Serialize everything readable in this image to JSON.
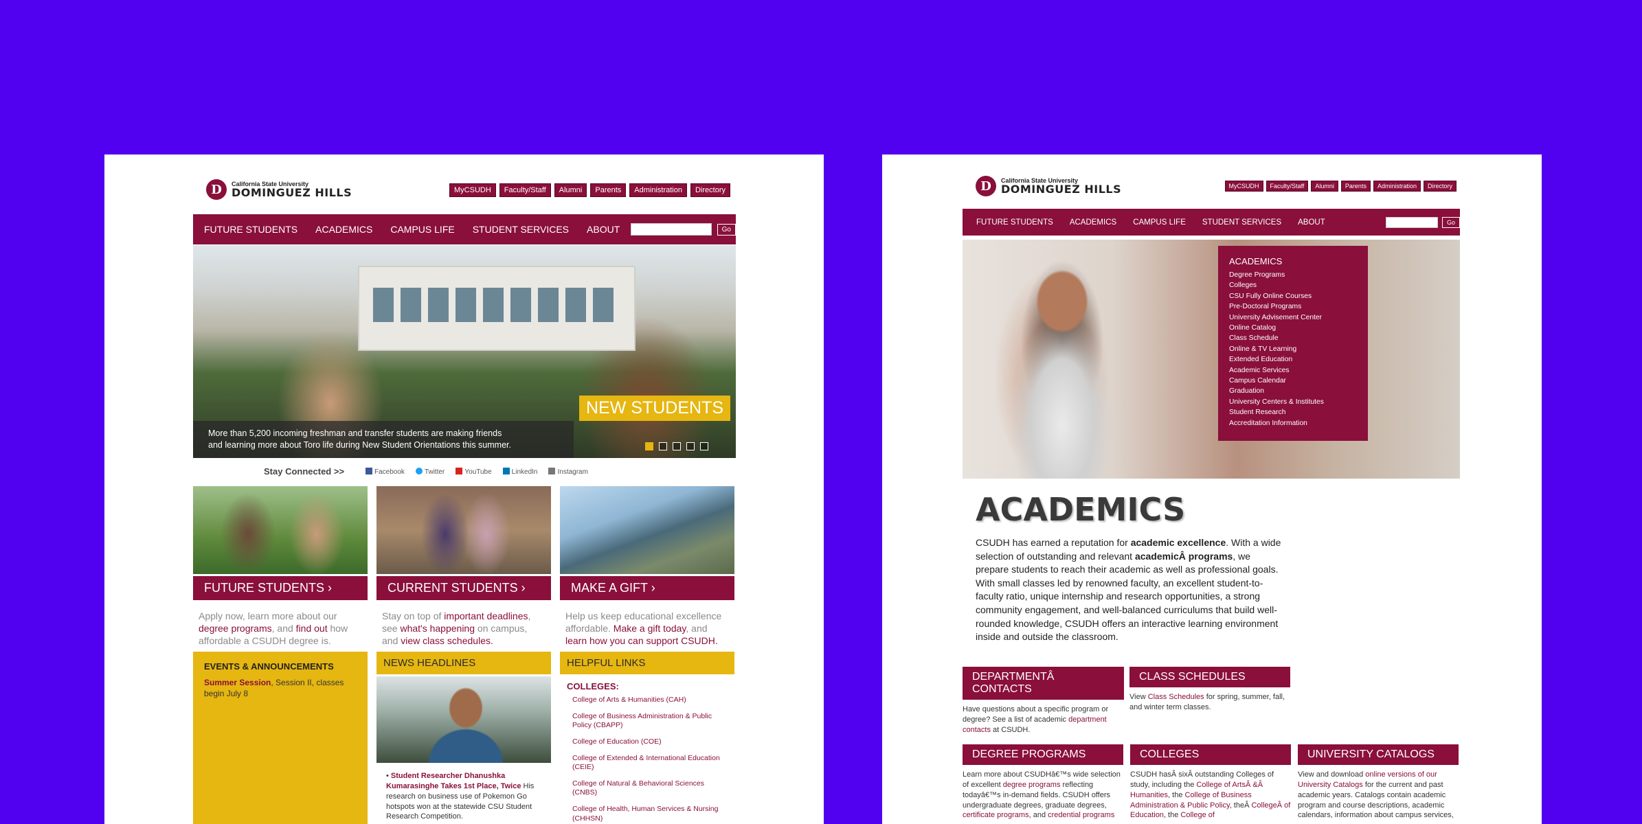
{
  "left": {
    "logo": {
      "line1": "California State University",
      "line2": "DOMINGUEZ HILLS"
    },
    "utility_links": [
      "MyCSUDH",
      "Faculty/Staff",
      "Alumni",
      "Parents",
      "Administration",
      "Directory"
    ],
    "nav": [
      "FUTURE STUDENTS",
      "ACADEMICS",
      "CAMPUS LIFE",
      "STUDENT SERVICES",
      "ABOUT"
    ],
    "search_go": "Go",
    "hero": {
      "caption_line1": "More than 5,200 incoming freshman and transfer students are making friends",
      "caption_line2": "and learning more about Toro life during New Student Orientations this summer.",
      "badge": "NEW STUDENTS",
      "active_slide": 1,
      "slide_count": 5
    },
    "stay_connected": "Stay Connected >>",
    "social": [
      "Facebook",
      "Twitter",
      "YouTube",
      "LinkedIn",
      "Instagram"
    ],
    "cards": [
      {
        "title": "FUTURE STUDENTS ›",
        "t1": "Apply now, learn more about our ",
        "l1": "degree programs",
        "t2": ", and ",
        "l2": "find out",
        "t3": " how affordable a CSUDH degree is."
      },
      {
        "title": "CURRENT STUDENTS ›",
        "t1": "Stay on top of ",
        "l1": "important deadlines",
        "t2": ", see ",
        "l2": "what's happening",
        "t3": " on campus, and ",
        "l3": "view class schedules."
      },
      {
        "title": "MAKE A GIFT ›",
        "t1": "Help us keep educational excellence affordable. ",
        "l1": "Make a gift today",
        "t2": ", and ",
        "l2": "learn how you can support CSUDH."
      }
    ],
    "events": {
      "heading": "EVENTS & ANNOUNCEMENTS",
      "link": "Summer Session",
      "text": ", Session II, classes begin July 8"
    },
    "news": {
      "heading": "NEWS HEADLINES",
      "item_title": "Student Researcher Dhanushka Kumarasinghe Takes 1st Place, Twice",
      "item_text": " His research on business use of Pokemon Go hotspots won at the statewide CSU Student Research Competition."
    },
    "helpful": {
      "heading": "HELPFUL LINKS",
      "sub": "COLLEGES:",
      "items": [
        "College of Arts & Humanities (CAH)",
        "College of Business Administration & Public Policy (CBAPP)",
        "College of Education (COE)",
        "College of Extended & International Education (CEIE)",
        "College of Natural & Behavioral Sciences (CNBS)",
        "College of Health, Human Services & Nursing (CHHSN)"
      ]
    }
  },
  "right": {
    "logo": {
      "line1": "California State University",
      "line2": "DOMINGUEZ HILLS"
    },
    "utility_links": [
      "MyCSUDH",
      "Faculty/Staff",
      "Alumni",
      "Parents",
      "Administration",
      "Directory"
    ],
    "nav": [
      "FUTURE STUDENTS",
      "ACADEMICS",
      "CAMPUS LIFE",
      "STUDENT SERVICES",
      "ABOUT"
    ],
    "search_go": "Go",
    "dropdown": {
      "heading": "ACADEMICS",
      "items": [
        "Degree Programs",
        "Colleges",
        "CSU Fully Online Courses",
        "Pre-Doctoral Programs",
        "University Advisement Center",
        "Online Catalog",
        "Class Schedule",
        "Online & TV Learning",
        "Extended Education",
        "Academic Services",
        "Campus Calendar",
        "Graduation",
        "University Centers & Institutes",
        "Student Research",
        "Accreditation Information"
      ]
    },
    "title": "ACADEMICS",
    "intro": {
      "t1": "CSUDH has earned a reputation for ",
      "b1": "academic excellence",
      "t2": ". With a wide selection of outstanding and relevant ",
      "b2": "academicÂ programs",
      "t3": ", we prepare students to reach their academic as well as professional goals. With small classes led by renowned faculty, an excellent student-to-faculty ratio, unique internship and research opportunities, a strong community engagement, and well-balanced curriculums that build well-rounded knowledge, CSUDH offers an interactive learning environment inside and outside the classroom."
    },
    "boxes": {
      "dept": {
        "title": "DEPARTMENTÂ CONTACTS",
        "t1": "Have questions about a specific program or degree? See a list of academic ",
        "l1": "department contacts",
        "t2": " at CSUDH."
      },
      "sched": {
        "title": "CLASS SCHEDULES",
        "t1": "View ",
        "l1": "Class Schedules",
        "t2": " for spring, summer, fall, and winter term classes."
      },
      "degree": {
        "title": "DEGREE PROGRAMS",
        "t1": "Learn more about CSUDHâ€™s wide selection of excellent ",
        "l1": "degree programs",
        "t2": " reflecting todayâ€™s in-demand fields. CSUDH offers undergraduate degrees, graduate degrees, ",
        "l2": "certificate programs",
        "t3": ", and ",
        "l3": "credential programs"
      },
      "colleges": {
        "title": "COLLEGES",
        "t1": "CSUDH hasÂ sixÂ outstanding Colleges of study, including the ",
        "l1": "College of ArtsÂ &Â Humanities",
        "t2": ", the ",
        "l2": "College of Business Administration & Public Policy",
        "t3": ", theÂ ",
        "l3": "CollegeÂ of Education",
        "t4": ", the ",
        "l4": "College of"
      },
      "catalogs": {
        "title": "UNIVERSITY CATALOGS",
        "t1": "View and download ",
        "l1": "online versions of our University Catalogs",
        "t2": " for the current and past academic years. Catalogs contain academic program and course descriptions, academic calendars, information about campus services,"
      }
    }
  }
}
